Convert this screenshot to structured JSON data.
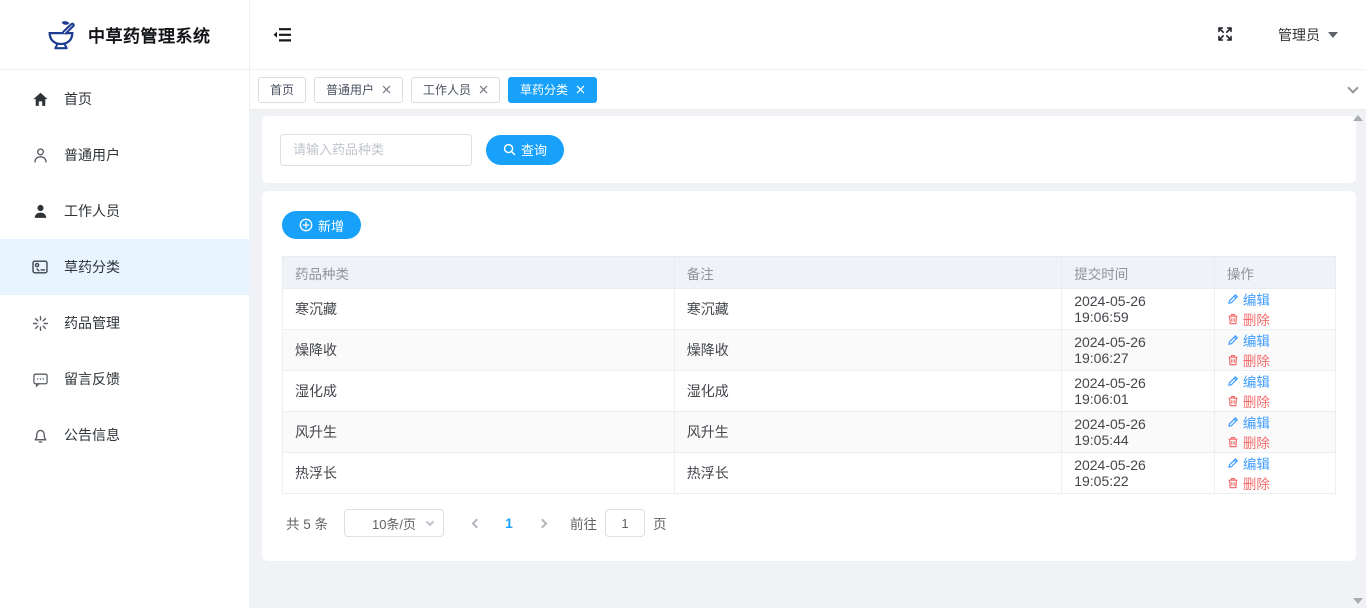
{
  "app": {
    "title": "中草药管理系统"
  },
  "topbar": {
    "admin_label": "管理员"
  },
  "sidebar": {
    "items": [
      {
        "label": "首页",
        "icon": "home-icon"
      },
      {
        "label": "普通用户",
        "icon": "user-outline-icon"
      },
      {
        "label": "工作人员",
        "icon": "user-filled-icon"
      },
      {
        "label": "草药分类",
        "icon": "category-card-icon",
        "active": true
      },
      {
        "label": "药品管理",
        "icon": "sparkle-icon"
      },
      {
        "label": "留言反馈",
        "icon": "message-icon"
      },
      {
        "label": "公告信息",
        "icon": "bell-icon"
      }
    ]
  },
  "tabs": [
    {
      "label": "首页",
      "closable": false,
      "active": false
    },
    {
      "label": "普通用户",
      "closable": true,
      "active": false
    },
    {
      "label": "工作人员",
      "closable": true,
      "active": false
    },
    {
      "label": "草药分类",
      "closable": true,
      "active": true
    }
  ],
  "search": {
    "placeholder": "请输入药品种类",
    "button_label": "查询"
  },
  "toolbar": {
    "add_label": "新增"
  },
  "table": {
    "headers": [
      "药品种类",
      "备注",
      "提交时间",
      "操作"
    ],
    "edit_label": "编辑",
    "delete_label": "删除",
    "rows": [
      {
        "type": "寒沉藏",
        "note": "寒沉藏",
        "time": "2024-05-26 19:06:59"
      },
      {
        "type": "燥降收",
        "note": "燥降收",
        "time": "2024-05-26 19:06:27"
      },
      {
        "type": "湿化成",
        "note": "湿化成",
        "time": "2024-05-26 19:06:01"
      },
      {
        "type": "风升生",
        "note": "风升生",
        "time": "2024-05-26 19:05:44"
      },
      {
        "type": "热浮长",
        "note": "热浮长",
        "time": "2024-05-26 19:05:22"
      }
    ]
  },
  "pagination": {
    "total_label": "共 5 条",
    "page_size_label": "10条/页",
    "current_page": "1",
    "goto_label": "前往",
    "goto_value": "1",
    "page_unit": "页"
  },
  "colors": {
    "primary": "#18a1fb",
    "edit_blue": "#409eff",
    "delete_red": "#f56c6c",
    "active_menu_bg": "#e8f4ff",
    "content_bg": "#f0f2f5"
  }
}
